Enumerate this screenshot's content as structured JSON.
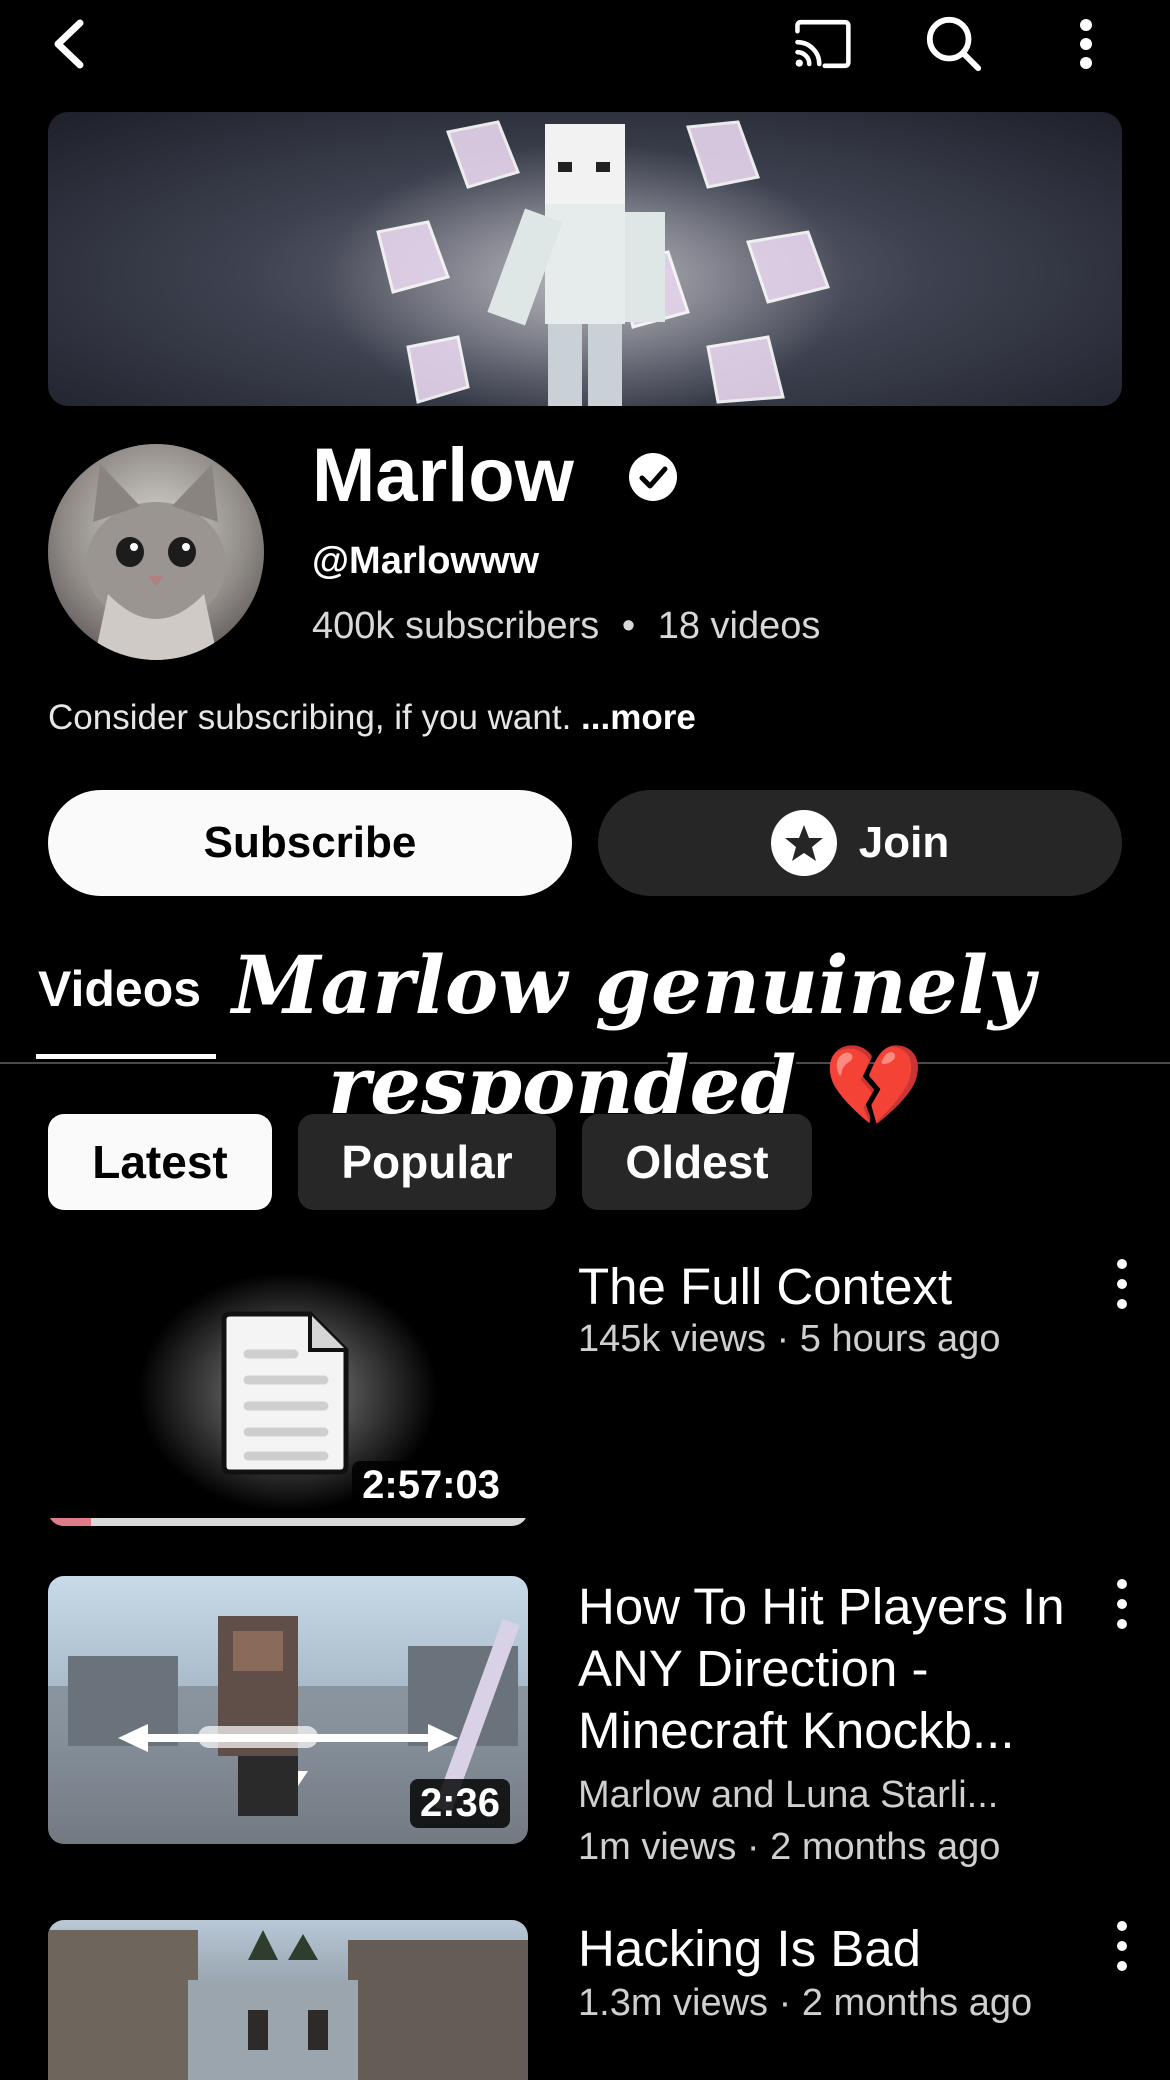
{
  "channel": {
    "name": "Marlow",
    "handle": "@Marlowww",
    "subscribers": "400k subscribers",
    "stats_separator": "•",
    "video_count": "18 videos",
    "description": "Consider subscribing, if you want.",
    "more_label": "...more"
  },
  "actions": {
    "subscribe_label": "Subscribe",
    "join_label": "Join"
  },
  "tabs": {
    "active": "Videos"
  },
  "overlay_caption": {
    "line1": "Marlow genuinely",
    "line2": "responded",
    "emoji": "💔"
  },
  "filters": [
    {
      "label": "Latest",
      "selected": true
    },
    {
      "label": "Popular",
      "selected": false
    },
    {
      "label": "Oldest",
      "selected": false
    }
  ],
  "videos": [
    {
      "title": "The Full Context",
      "meta": "145k views · 5 hours ago",
      "duration": "2:57:03"
    },
    {
      "title": "How To Hit Players In ANY Direction - Minecraft Knockb...",
      "author": "Marlow and Luna Starli...",
      "meta": "1m views · 2 months ago",
      "duration": "2:36"
    },
    {
      "title": "Hacking Is Bad",
      "meta": "1.3m views · 2 months ago"
    }
  ],
  "icons": {
    "back": "back-arrow-icon",
    "cast": "cast-icon",
    "search": "search-icon",
    "more": "more-vert-icon",
    "verified": "verified-check-icon",
    "join": "star-icon"
  },
  "colors": {
    "background": "#000000",
    "chip_selected": "#fafafa",
    "chip_unselected": "#272727",
    "join_button": "#262626"
  }
}
